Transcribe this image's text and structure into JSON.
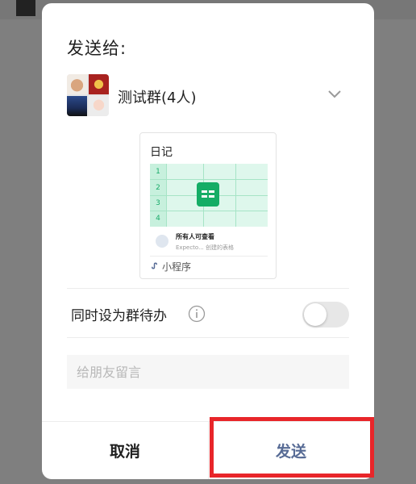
{
  "dialog": {
    "title": "发送给:",
    "recipient": {
      "name": "测试群(4人)"
    },
    "share_card": {
      "title": "日记",
      "row_numbers": [
        "1",
        "2",
        "3",
        "4"
      ],
      "meta_title": "所有人可查看",
      "meta_subtitle": "Expecto... 创建的表格",
      "footer_label": "小程序"
    },
    "todo": {
      "label": "同时设为群待办",
      "enabled": false
    },
    "message": {
      "value": "",
      "placeholder": "给朋友留言"
    },
    "buttons": {
      "cancel": "取消",
      "send": "发送"
    }
  },
  "colors": {
    "send_text": "#576b95",
    "highlight": "#e8262a",
    "sheet_green": "#15ad66"
  }
}
